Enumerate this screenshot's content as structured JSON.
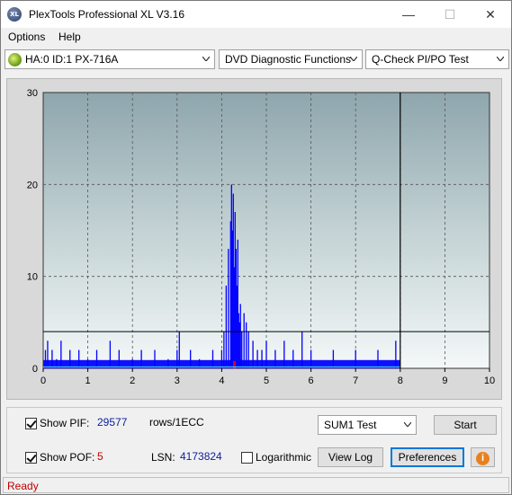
{
  "window": {
    "title": "PlexTools Professional XL V3.16",
    "icon_text": "XL",
    "minimize": "—",
    "maximize": "☐",
    "close": "✕"
  },
  "menu": {
    "options": "Options",
    "help": "Help"
  },
  "toolbar": {
    "drive": "HA:0 ID:1  PX-716A",
    "function": "DVD Diagnostic Functions",
    "test": "Q-Check PI/PO Test"
  },
  "chart_data": {
    "type": "bar",
    "x_ticks": [
      "0",
      "1",
      "2",
      "3",
      "4",
      "5",
      "6",
      "7",
      "8",
      "9",
      "10"
    ],
    "y_ticks": [
      "0",
      "10",
      "20",
      "30"
    ],
    "xlim": [
      0,
      10
    ],
    "ylim": [
      0,
      30
    ],
    "threshold_line": 4,
    "scan_end_x": 8,
    "series": [
      {
        "color": "#0000ff",
        "x": [
          0.05,
          0.1,
          0.2,
          0.3,
          0.4,
          0.6,
          0.8,
          1.0,
          1.2,
          1.5,
          1.7,
          2.0,
          2.2,
          2.5,
          2.8,
          3.0,
          3.05,
          3.3,
          3.5,
          3.8,
          4.0,
          4.05,
          4.1,
          4.15,
          4.2,
          4.22,
          4.24,
          4.26,
          4.28,
          4.3,
          4.32,
          4.34,
          4.36,
          4.38,
          4.4,
          4.42,
          4.45,
          4.5,
          4.55,
          4.6,
          4.7,
          4.8,
          4.9,
          5.0,
          5.2,
          5.4,
          5.6,
          5.8,
          6.0,
          6.5,
          7.0,
          7.5,
          7.9
        ],
        "values": [
          2,
          3,
          2,
          1,
          3,
          2,
          2,
          1,
          2,
          3,
          2,
          1,
          2,
          2,
          1,
          2,
          4,
          2,
          1,
          2,
          2,
          4,
          9,
          13,
          16,
          20,
          15,
          19,
          11,
          17,
          13,
          9,
          14,
          6,
          5,
          7,
          4,
          6,
          5,
          4,
          3,
          2,
          2,
          3,
          2,
          3,
          2,
          4,
          2,
          2,
          2,
          2,
          3
        ]
      },
      {
        "color": "#ff0000",
        "x": [
          4.27,
          4.3
        ],
        "values": [
          0.8,
          0.8
        ]
      }
    ]
  },
  "bottom": {
    "show_pif_label": "Show PIF:",
    "pif_value": "29577",
    "pif_unit": "rows/1ECC",
    "show_pof_label": "Show POF:",
    "pof_value": "5",
    "lsn_label": "LSN:",
    "lsn_value": "4173824",
    "logarithmic_label": "Logarithmic",
    "sum_select": "SUM1 Test",
    "start_button": "Start",
    "view_log_button": "View Log",
    "preferences_button": "Preferences",
    "info_icon": "i"
  },
  "status": {
    "text": "Ready"
  }
}
